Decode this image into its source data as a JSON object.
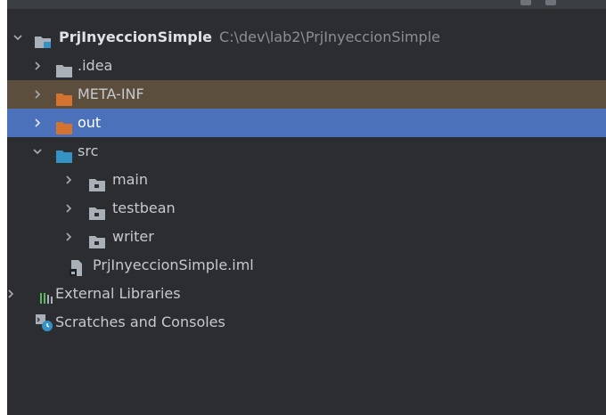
{
  "tree": {
    "root": {
      "name": "PrjInyeccionSimple",
      "path": "C:\\dev\\lab2\\PrjInyeccionSimple"
    },
    "items": [
      {
        "label": ".idea"
      },
      {
        "label": "META-INF"
      },
      {
        "label": "out"
      },
      {
        "label": "src"
      },
      {
        "label": "main"
      },
      {
        "label": "testbean"
      },
      {
        "label": "writer"
      },
      {
        "label": "PrjInyeccionSimple.iml"
      },
      {
        "label": "External Libraries"
      },
      {
        "label": "Scratches and Consoles"
      }
    ]
  },
  "colors": {
    "panel_bg": "#2b2d30",
    "selection": "#4a71ba",
    "highlight": "#5b4e3c",
    "folder_gray": "#aab0b8",
    "folder_orange": "#d4722f",
    "folder_blue": "#3592c4"
  },
  "icons": {
    "expand": "chevron-right-icon",
    "collapse": "chevron-down-icon",
    "module": "module-folder-icon",
    "folder": "folder-icon",
    "package": "package-folder-icon",
    "iml": "iml-file-icon",
    "libraries": "libraries-icon",
    "scratches": "scratches-icon"
  }
}
